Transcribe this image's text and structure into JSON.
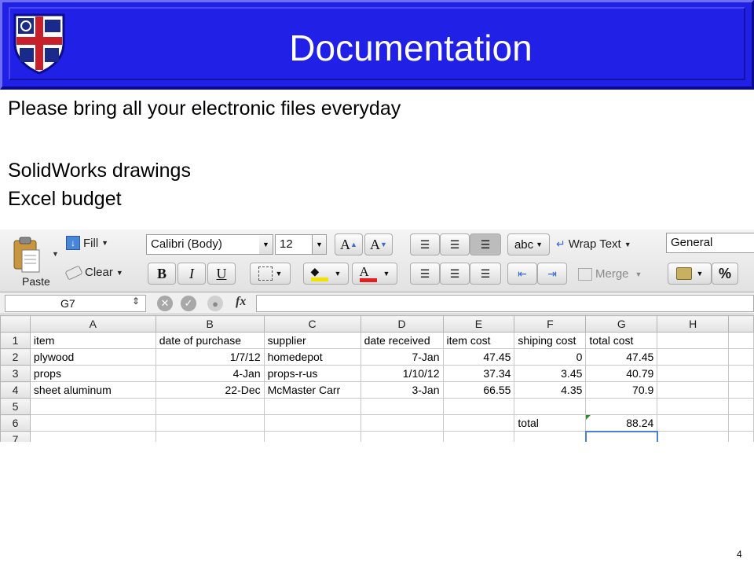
{
  "slide": {
    "title": "Documentation",
    "lines": [
      "Please bring all your electronic files everyday",
      "SolidWorks drawings",
      "Excel budget"
    ],
    "slide_number": "4"
  },
  "excel": {
    "ribbon": {
      "paste_label": "Paste",
      "fill_label": "Fill",
      "clear_label": "Clear",
      "font_name": "Calibri (Body)",
      "font_size": "12",
      "grow_font": "A",
      "shrink_font": "A",
      "bold": "B",
      "italic": "I",
      "underline": "U",
      "orientation_label": "abc",
      "wrap_text_label": "Wrap Text",
      "merge_label": "Merge",
      "number_format": "General",
      "percent": "%",
      "icons": [
        "paste-icon",
        "fill-icon",
        "clear-icon",
        "align-icons",
        "borders-icon",
        "fill-color-icon",
        "font-color-icon",
        "indent-icons",
        "currency-icon"
      ]
    },
    "formula_bar": {
      "name_box": "G7",
      "fx_label": "fx"
    },
    "column_headers": [
      "A",
      "B",
      "C",
      "D",
      "E",
      "F",
      "G",
      "H"
    ],
    "row_headers": [
      "1",
      "2",
      "3",
      "4",
      "5",
      "6",
      "7"
    ],
    "rows": [
      [
        "item",
        "date of purchase",
        "supplier",
        "date received",
        "item cost",
        "shiping cost",
        "total cost",
        ""
      ],
      [
        "plywood",
        "1/7/12",
        "homedepot",
        "7-Jan",
        "47.45",
        "0",
        "47.45",
        ""
      ],
      [
        "props",
        "4-Jan",
        "props-r-us",
        "1/10/12",
        "37.34",
        "3.45",
        "40.79",
        ""
      ],
      [
        "sheet aluminum",
        "22-Dec",
        "McMaster Carr",
        "3-Jan",
        "66.55",
        "4.35",
        "70.9",
        ""
      ],
      [
        "",
        "",
        "",
        "",
        "",
        "",
        "",
        ""
      ],
      [
        "",
        "",
        "",
        "",
        "",
        "total",
        "88.24",
        ""
      ],
      [
        "",
        "",
        "",
        "",
        "",
        "",
        "",
        ""
      ]
    ]
  },
  "colors": {
    "banner": "#2020e6",
    "title_text": "#ffffff",
    "selection": "#4a7fd6"
  }
}
